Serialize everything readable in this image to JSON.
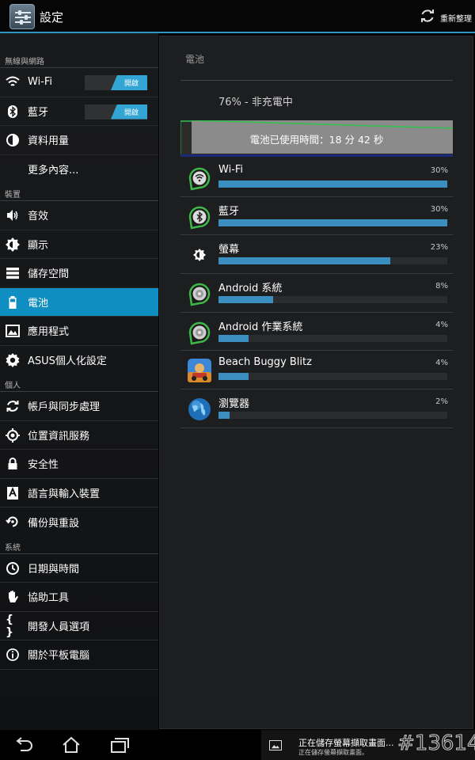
{
  "window": {
    "title": "設定",
    "refresh_label": "重新整理"
  },
  "nav": {
    "sections": [
      {
        "header": "無線與網路",
        "items": [
          {
            "label": "Wi-Fi",
            "icon": "wifi-icon",
            "toggle": "開啟"
          },
          {
            "label": "藍牙",
            "icon": "bluetooth-icon",
            "toggle": "開啟"
          },
          {
            "label": "資料用量",
            "icon": "data-usage-icon"
          },
          {
            "label": "更多內容...",
            "icon": ""
          }
        ]
      },
      {
        "header": "裝置",
        "items": [
          {
            "label": "音效",
            "icon": "sound-icon"
          },
          {
            "label": "顯示",
            "icon": "display-icon"
          },
          {
            "label": "儲存空間",
            "icon": "storage-icon"
          },
          {
            "label": "電池",
            "icon": "battery-icon",
            "selected": true
          },
          {
            "label": "應用程式",
            "icon": "apps-icon"
          },
          {
            "label": "ASUS個人化設定",
            "icon": "gear-icon"
          }
        ]
      },
      {
        "header": "個人",
        "items": [
          {
            "label": "帳戶與同步處理",
            "icon": "sync-icon"
          },
          {
            "label": "位置資訊服務",
            "icon": "location-icon"
          },
          {
            "label": "安全性",
            "icon": "lock-icon"
          },
          {
            "label": "語言與輸入裝置",
            "icon": "keyboard-icon"
          },
          {
            "label": "備份與重設",
            "icon": "backup-icon"
          }
        ]
      },
      {
        "header": "系統",
        "items": [
          {
            "label": "日期與時間",
            "icon": "clock-icon"
          },
          {
            "label": "協助工具",
            "icon": "hand-icon"
          },
          {
            "label": "開發人員選項",
            "icon": "braces-icon"
          },
          {
            "label": "關於平板電腦",
            "icon": "info-icon"
          }
        ]
      }
    ]
  },
  "battery": {
    "title": "電池",
    "status": "76% - 非充電中",
    "graph_text": "電池已使用時間：18 分 42 秒",
    "level_percent": 76,
    "usage": [
      {
        "name": "Wi-Fi",
        "percent_label": "30%",
        "bar_percent": 100,
        "icon": "wifi-app-icon"
      },
      {
        "name": "藍牙",
        "percent_label": "30%",
        "bar_percent": 100,
        "icon": "bluetooth-app-icon"
      },
      {
        "name": "螢幕",
        "percent_label": "23%",
        "bar_percent": 75,
        "icon": "screen-brightness-icon"
      },
      {
        "name": "Android 系統",
        "percent_label": "8%",
        "bar_percent": 24,
        "icon": "android-system-icon"
      },
      {
        "name": "Android 作業系統",
        "percent_label": "4%",
        "bar_percent": 13,
        "icon": "android-os-icon"
      },
      {
        "name": "Beach Buggy Blitz",
        "percent_label": "4%",
        "bar_percent": 13,
        "icon": "game-app-icon"
      },
      {
        "name": "瀏覽器",
        "percent_label": "2%",
        "bar_percent": 5,
        "icon": "browser-globe-icon"
      }
    ]
  },
  "notification": {
    "title": "正在儲存螢幕擷取畫面...",
    "subtitle": "正在儲存螢幕擷取畫面。",
    "watermark": "#13614"
  },
  "colors": {
    "accent": "#0e8ec1",
    "bar": "#3a8fc0",
    "toggle_on": "#33a5d4"
  }
}
